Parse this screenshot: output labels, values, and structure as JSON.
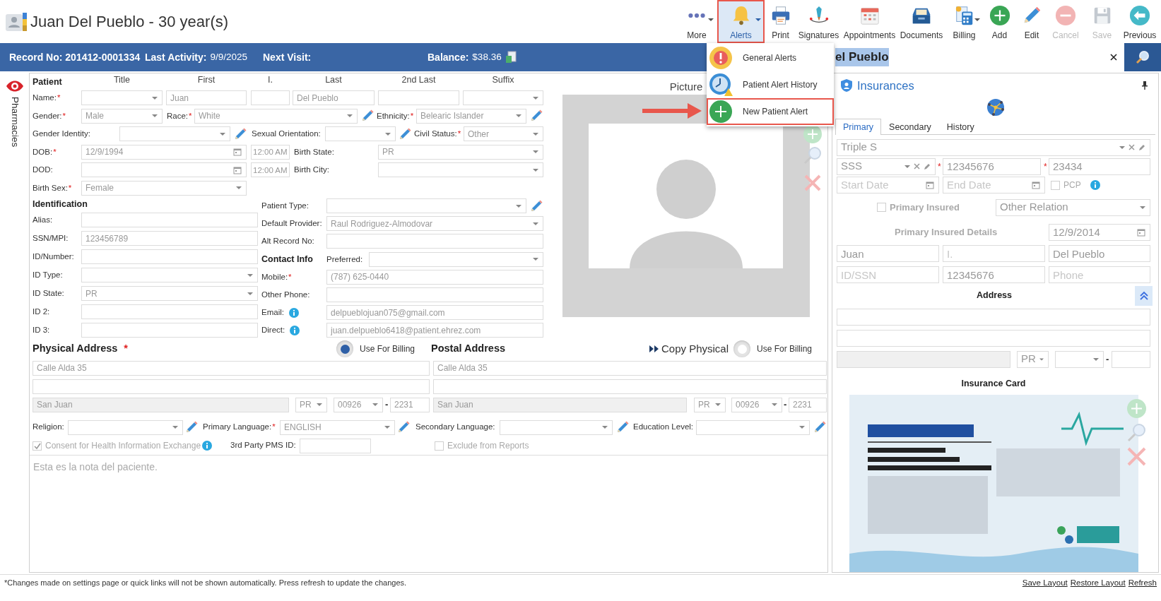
{
  "header": {
    "title": "Juan Del Pueblo - 30 year(s)"
  },
  "toolbar": [
    {
      "label": "More",
      "dropdown": true,
      "expanded": false,
      "disabled": false,
      "highlighted": false
    },
    {
      "label": "Alerts",
      "dropdown": true,
      "expanded": true,
      "disabled": false,
      "highlighted": true
    },
    {
      "label": "Print",
      "dropdown": false,
      "expanded": false,
      "disabled": false,
      "highlighted": false
    },
    {
      "label": "Signatures",
      "dropdown": false,
      "expanded": false,
      "disabled": false,
      "highlighted": false
    },
    {
      "label": "Appointments",
      "dropdown": false,
      "expanded": false,
      "disabled": false,
      "highlighted": false
    },
    {
      "label": "Documents",
      "dropdown": false,
      "expanded": false,
      "disabled": false,
      "highlighted": false
    },
    {
      "label": "Billing",
      "dropdown": true,
      "expanded": false,
      "disabled": false,
      "highlighted": false
    },
    {
      "label": "Add",
      "dropdown": false,
      "expanded": false,
      "disabled": false,
      "highlighted": false
    },
    {
      "label": "Edit",
      "dropdown": false,
      "expanded": false,
      "disabled": false,
      "highlighted": false
    },
    {
      "label": "Cancel",
      "dropdown": false,
      "expanded": false,
      "disabled": true,
      "highlighted": false
    },
    {
      "label": "Save",
      "dropdown": false,
      "expanded": false,
      "disabled": true,
      "highlighted": false
    },
    {
      "label": "Previous",
      "dropdown": false,
      "expanded": false,
      "disabled": false,
      "highlighted": false
    }
  ],
  "alerts_menu": [
    {
      "label": "General Alerts",
      "highlighted": false,
      "arrow": false
    },
    {
      "label": "Patient Alert History",
      "highlighted": false,
      "arrow": false
    },
    {
      "label": "New Patient Alert",
      "highlighted": true,
      "arrow": true
    }
  ],
  "info_bar": [
    {
      "label": "Record No: 201412-0001334"
    },
    {
      "label": "Last Activity:",
      "value": "9/9/2025"
    },
    {
      "label": "Next Visit:"
    },
    {
      "label": "Balance:",
      "value": "$38.36"
    }
  ],
  "search": {
    "value": "el Pueblo",
    "text_selected": true
  },
  "side_tabs": [
    {
      "label": "Pharmacies"
    }
  ],
  "patient": {
    "heading": "Patient",
    "column_heads": [
      "Title",
      "First",
      "I.",
      "Last",
      "2nd Last",
      "Suffix"
    ],
    "rows": [
      {
        "fields": [
          {
            "kind": "label",
            "text": "Name:",
            "required": "*"
          },
          {
            "kind": "select"
          },
          {
            "kind": "input",
            "value": "Juan"
          },
          {
            "kind": "input"
          },
          {
            "kind": "input",
            "value": "Del Pueblo"
          },
          {
            "kind": "input"
          },
          {
            "kind": "select"
          }
        ]
      },
      {
        "fields": [
          {
            "kind": "label",
            "text": "Gender:",
            "required": "*"
          },
          {
            "kind": "select",
            "value": "Male"
          },
          {
            "kind": "label",
            "text": "Race:",
            "required": "*"
          },
          {
            "kind": "select",
            "value": "White"
          },
          {
            "kind": "edit"
          },
          {
            "kind": "label",
            "text": "Ethnicity:",
            "required": "*"
          },
          {
            "kind": "select",
            "value": "Belearic Islander"
          },
          {
            "kind": "edit"
          }
        ]
      },
      {
        "fields": [
          {
            "kind": "label",
            "text": "Gender Identity:"
          },
          {
            "kind": "select"
          },
          {
            "kind": "edit"
          },
          {
            "kind": "label",
            "text": "Sexual Orientation:"
          },
          {
            "kind": "select"
          },
          {
            "kind": "edit"
          },
          {
            "kind": "label",
            "text": "Civil Status:",
            "required": "*"
          },
          {
            "kind": "select",
            "value": "Other"
          }
        ]
      },
      {
        "fields": [
          {
            "kind": "label",
            "text": "DOB:",
            "required": "*"
          },
          {
            "kind": "date",
            "value": "12/9/1994"
          },
          {
            "kind": "time",
            "value": "12:00 AM"
          },
          {
            "kind": "label",
            "text": "Birth State:"
          },
          {
            "kind": "select",
            "value": "PR"
          }
        ]
      },
      {
        "fields": [
          {
            "kind": "label",
            "text": "DOD:"
          },
          {
            "kind": "date"
          },
          {
            "kind": "time",
            "value": "12:00 AM"
          },
          {
            "kind": "label",
            "text": "Birth City:"
          },
          {
            "kind": "select"
          }
        ]
      },
      {
        "fields": [
          {
            "kind": "label",
            "text": "Birth Sex:",
            "required": "*"
          },
          {
            "kind": "select",
            "value": "Female"
          }
        ]
      }
    ]
  },
  "identification": {
    "heading": "Identification",
    "rows": [
      [
        {
          "kind": "label",
          "text": "Alias:"
        },
        {
          "kind": "input"
        }
      ],
      [
        {
          "kind": "label",
          "text": "SSN/MPI:"
        },
        {
          "kind": "input",
          "value": "123456789"
        }
      ],
      [
        {
          "kind": "label",
          "text": "ID/Number:"
        },
        {
          "kind": "input"
        }
      ],
      [
        {
          "kind": "label",
          "text": "ID Type:"
        },
        {
          "kind": "select"
        }
      ],
      [
        {
          "kind": "label",
          "text": "ID State:"
        },
        {
          "kind": "select",
          "value": "PR"
        }
      ],
      [
        {
          "kind": "label",
          "text": "ID 2:"
        },
        {
          "kind": "input"
        }
      ],
      [
        {
          "kind": "label",
          "text": "ID 3:"
        },
        {
          "kind": "input"
        }
      ]
    ]
  },
  "contact": {
    "rows": [
      [
        {
          "kind": "label",
          "text": "Patient Type:"
        },
        {
          "kind": "select"
        },
        {
          "kind": "edit"
        }
      ],
      [
        {
          "kind": "label",
          "text": "Default Provider:"
        },
        {
          "kind": "select",
          "value": "Raul Rodriguez-Almodovar"
        }
      ],
      [
        {
          "kind": "label",
          "text": "Alt Record No:"
        },
        {
          "kind": "input"
        }
      ],
      [
        {
          "kind": "heading",
          "text": "Contact Info"
        },
        {
          "kind": "label",
          "text": "Preferred:"
        },
        {
          "kind": "select"
        }
      ],
      [
        {
          "kind": "label",
          "text": "Mobile:",
          "required": "*"
        },
        {
          "kind": "input",
          "value": "(787) 625-0440"
        }
      ],
      [
        {
          "kind": "label",
          "text": "Other Phone:"
        },
        {
          "kind": "input"
        }
      ],
      [
        {
          "kind": "label",
          "text": "Email:"
        },
        {
          "kind": "info"
        },
        {
          "kind": "input",
          "value": "delpueblojuan075@gmail.com"
        }
      ],
      [
        {
          "kind": "label",
          "text": "Direct:"
        },
        {
          "kind": "info"
        },
        {
          "kind": "input",
          "value": "juan.delpueblo6418@patient.ehrez.com"
        }
      ]
    ]
  },
  "picture": {
    "title": "Picture"
  },
  "addresses": [
    {
      "header": [
        {
          "kind": "title",
          "text": "Physical Address",
          "required": "*"
        },
        {
          "kind": "radio",
          "label": "Use For Billing",
          "checked": true
        }
      ],
      "rows": [
        [
          {
            "kind": "input",
            "value": "Calle Alda 35"
          }
        ],
        [
          {
            "kind": "input"
          }
        ],
        [
          {
            "kind": "input",
            "value": "San Juan",
            "shaded": true
          },
          {
            "kind": "select",
            "value": "PR"
          },
          {
            "kind": "select",
            "value": "00926"
          },
          {
            "kind": "sep",
            "text": "-"
          },
          {
            "kind": "input",
            "value": "2231"
          }
        ]
      ]
    },
    {
      "header": [
        {
          "kind": "title",
          "text": "Postal Address"
        },
        {
          "kind": "copy",
          "label": "Copy Physical"
        },
        {
          "kind": "radio",
          "label": "Use For Billing",
          "checked": false
        }
      ],
      "rows": [
        [
          {
            "kind": "input",
            "value": "Calle Alda 35"
          }
        ],
        [
          {
            "kind": "input"
          }
        ],
        [
          {
            "kind": "input",
            "value": "San Juan",
            "shaded": true
          },
          {
            "kind": "select",
            "value": "PR"
          },
          {
            "kind": "select",
            "value": "00926"
          },
          {
            "kind": "sep",
            "text": "-"
          },
          {
            "kind": "input",
            "value": "2231"
          }
        ]
      ]
    }
  ],
  "details": {
    "rows": [
      [
        {
          "kind": "label",
          "text": "Religion:"
        },
        {
          "kind": "select"
        },
        {
          "kind": "edit"
        },
        {
          "kind": "label",
          "text": "Primary Language:",
          "required": "*"
        },
        {
          "kind": "select",
          "value": "ENGLISH"
        },
        {
          "kind": "edit"
        },
        {
          "kind": "label",
          "text": "Secondary Language:"
        },
        {
          "kind": "select"
        },
        {
          "kind": "edit"
        },
        {
          "kind": "label",
          "text": "Education Level:"
        },
        {
          "kind": "select"
        },
        {
          "kind": "edit"
        }
      ],
      [
        {
          "kind": "checkbox",
          "label": "Consent for Health Information Exchange",
          "checked": true,
          "emphasis": false
        },
        {
          "kind": "info"
        },
        {
          "kind": "label",
          "text": "3rd Party PMS ID:"
        },
        {
          "kind": "input"
        },
        {
          "kind": "checkbox",
          "label": "Exclude from Reports",
          "checked": false,
          "emphasis": false
        }
      ]
    ]
  },
  "notes": {
    "value": "Esta es la nota del paciente."
  },
  "insurances": {
    "title": "Insurances",
    "tabs": [
      {
        "label": "Primary",
        "selected": true
      },
      {
        "label": "Secondary",
        "selected": false
      },
      {
        "label": "History",
        "selected": false
      }
    ],
    "rows": [
      [
        {
          "kind": "combo",
          "value": "Triple S"
        }
      ],
      [
        {
          "kind": "combo",
          "value": "SSS"
        },
        {
          "kind": "mark",
          "text": "*"
        },
        {
          "kind": "input",
          "value": "12345676"
        },
        {
          "kind": "mark",
          "text": "*"
        },
        {
          "kind": "input",
          "value": "23434"
        }
      ],
      [
        {
          "kind": "date",
          "placeholder": "Start Date"
        },
        {
          "kind": "date",
          "placeholder": "End Date"
        },
        {
          "kind": "checkbox",
          "label": "PCP",
          "checked": false,
          "emphasis": false
        },
        {
          "kind": "info"
        }
      ],
      [
        {
          "kind": "checkbox",
          "label": "Primary Insured",
          "checked": false,
          "emphasis": true
        },
        {
          "kind": "select",
          "value": "Other Relation"
        }
      ],
      [
        {
          "kind": "caption",
          "text": "Primary Insured Details"
        },
        {
          "kind": "date",
          "value": "12/9/2014"
        }
      ],
      [
        {
          "kind": "input",
          "value": "Juan"
        },
        {
          "kind": "input",
          "placeholder": "I."
        },
        {
          "kind": "input",
          "value": "Del Pueblo"
        }
      ],
      [
        {
          "kind": "input",
          "placeholder": "ID/SSN"
        },
        {
          "kind": "input",
          "value": "12345676"
        },
        {
          "kind": "input",
          "placeholder": "Phone"
        }
      ],
      [
        {
          "kind": "heading",
          "text": "Address"
        },
        {
          "kind": "collapse"
        }
      ],
      [
        {
          "kind": "input"
        }
      ],
      [
        {
          "kind": "input"
        }
      ],
      [
        {
          "kind": "input",
          "shaded": true
        },
        {
          "kind": "select",
          "value": "PR"
        },
        {
          "kind": "select"
        },
        {
          "kind": "sep",
          "text": "-"
        },
        {
          "kind": "input"
        }
      ],
      [
        {
          "kind": "heading",
          "text": "Insurance Card"
        }
      ]
    ],
    "card": {
      "kind": "picture"
    }
  },
  "footer": {
    "note": "*Changes made on settings page or quick links will not be shown automatically. Press refresh to update the changes.",
    "links": [
      "Save Layout",
      "Restore Layout",
      "Refresh"
    ]
  }
}
